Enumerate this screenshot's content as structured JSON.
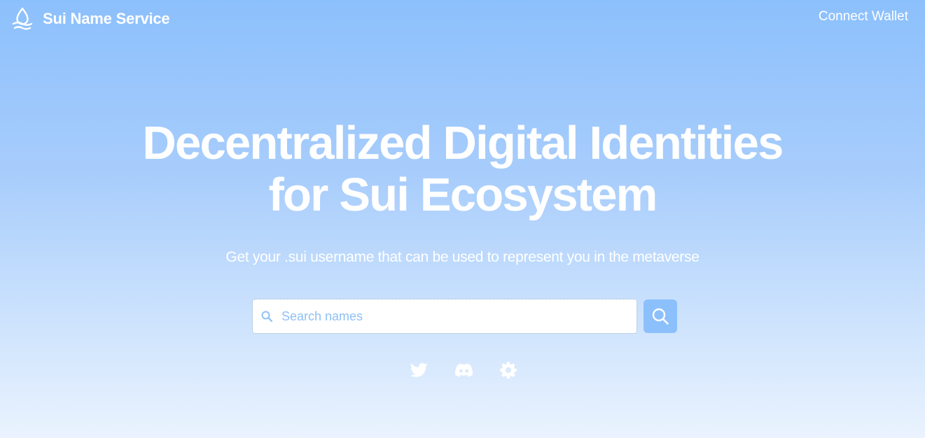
{
  "header": {
    "brand_name": "Sui Name Service",
    "connect_label": "Connect Wallet"
  },
  "hero": {
    "title_line1": "Decentralized Digital Identities",
    "title_line2": "for Sui Ecosystem",
    "subtitle": "Get your .sui username that can be used to represent you in the metaverse"
  },
  "search": {
    "placeholder": "Search names",
    "value": ""
  },
  "socials": [
    {
      "icon": "twitter-icon"
    },
    {
      "icon": "discord-icon"
    },
    {
      "icon": "gear-icon"
    }
  ],
  "colors": {
    "background_top": "#8cc0fc",
    "background_bottom": "#eaf3fe",
    "accent": "#8cc0fc",
    "text": "#ffffff",
    "placeholder": "#8fc1f4"
  }
}
